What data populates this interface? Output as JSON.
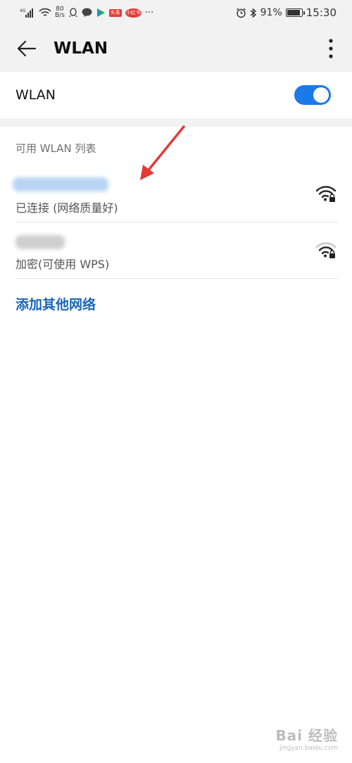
{
  "status_bar": {
    "network_type": "4G",
    "speed_value": "80",
    "speed_unit": "B/s",
    "badge_1": "头条",
    "badge_2": "小红书",
    "more": "···",
    "battery_percent": "91%",
    "battery_level": 0.91,
    "time": "15:30"
  },
  "app_bar": {
    "title": "WLAN"
  },
  "wlan_toggle": {
    "label": "WLAN",
    "enabled": true
  },
  "networks_section": {
    "header": "可用 WLAN 列表",
    "networks": [
      {
        "status": "已连接 (网络质量好)"
      },
      {
        "status": "加密(可使用 WPS)"
      }
    ],
    "add_network": "添加其他网络"
  },
  "watermark": {
    "main": "Bai 经验",
    "sub": "jingyan.baidu.com"
  },
  "colors": {
    "accent": "#1a7ae8",
    "link": "#1a66b8",
    "annotation": "#e53935"
  }
}
